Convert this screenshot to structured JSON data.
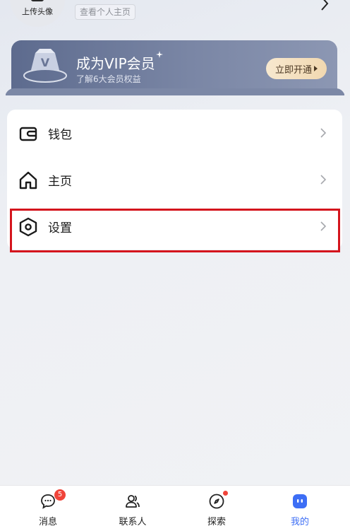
{
  "profile": {
    "upload_avatar_label": "上传头像",
    "view_homepage_label": "查看个人主页"
  },
  "vip": {
    "title": "成为VIP会员",
    "subtitle": "了解6大会员权益",
    "button_label": "立即开通"
  },
  "menu": {
    "items": [
      {
        "label": "钱包",
        "icon": "wallet-icon"
      },
      {
        "label": "主页",
        "icon": "home-icon"
      },
      {
        "label": "设置",
        "icon": "settings-icon"
      }
    ]
  },
  "tabbar": {
    "items": [
      {
        "label": "消息",
        "icon": "message-icon",
        "badge": "5"
      },
      {
        "label": "联系人",
        "icon": "contacts-icon"
      },
      {
        "label": "探索",
        "icon": "compass-icon"
      },
      {
        "label": "我的",
        "icon": "profile-icon"
      }
    ],
    "active_color": "#3d6ef5",
    "badge_color": "#f0443a"
  },
  "colors": {
    "highlight_border": "#d4151d",
    "vip_gold": "#f3ddb8"
  }
}
